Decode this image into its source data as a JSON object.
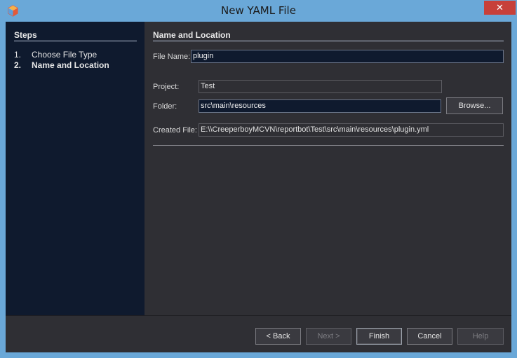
{
  "window": {
    "title": "New YAML File",
    "close_symbol": "✕"
  },
  "steps": {
    "title": "Steps",
    "items": [
      {
        "num": "1.",
        "label": "Choose File Type"
      },
      {
        "num": "2.",
        "label": "Name and Location"
      }
    ]
  },
  "form": {
    "title": "Name and Location",
    "file_name_label": "File Name:",
    "file_name_value": "plugin",
    "project_label": "Project:",
    "project_value": "Test",
    "folder_label": "Folder:",
    "folder_value": "src\\main\\resources",
    "browse_label": "Browse...",
    "created_file_label": "Created File:",
    "created_file_value": "E:\\\\CreeperboyMCVN\\reportbot\\Test\\src\\main\\resources\\plugin.yml"
  },
  "buttons": {
    "back": "< Back",
    "next": "Next >",
    "finish": "Finish",
    "cancel": "Cancel",
    "help": "Help"
  },
  "colors": {
    "titlebar": "#6aa8d8",
    "close": "#c7403a",
    "steps_panel": "#0f1a2e",
    "content": "#2f2f34"
  },
  "icons": {
    "app": "netbeans-cube-icon",
    "close": "close-icon"
  }
}
